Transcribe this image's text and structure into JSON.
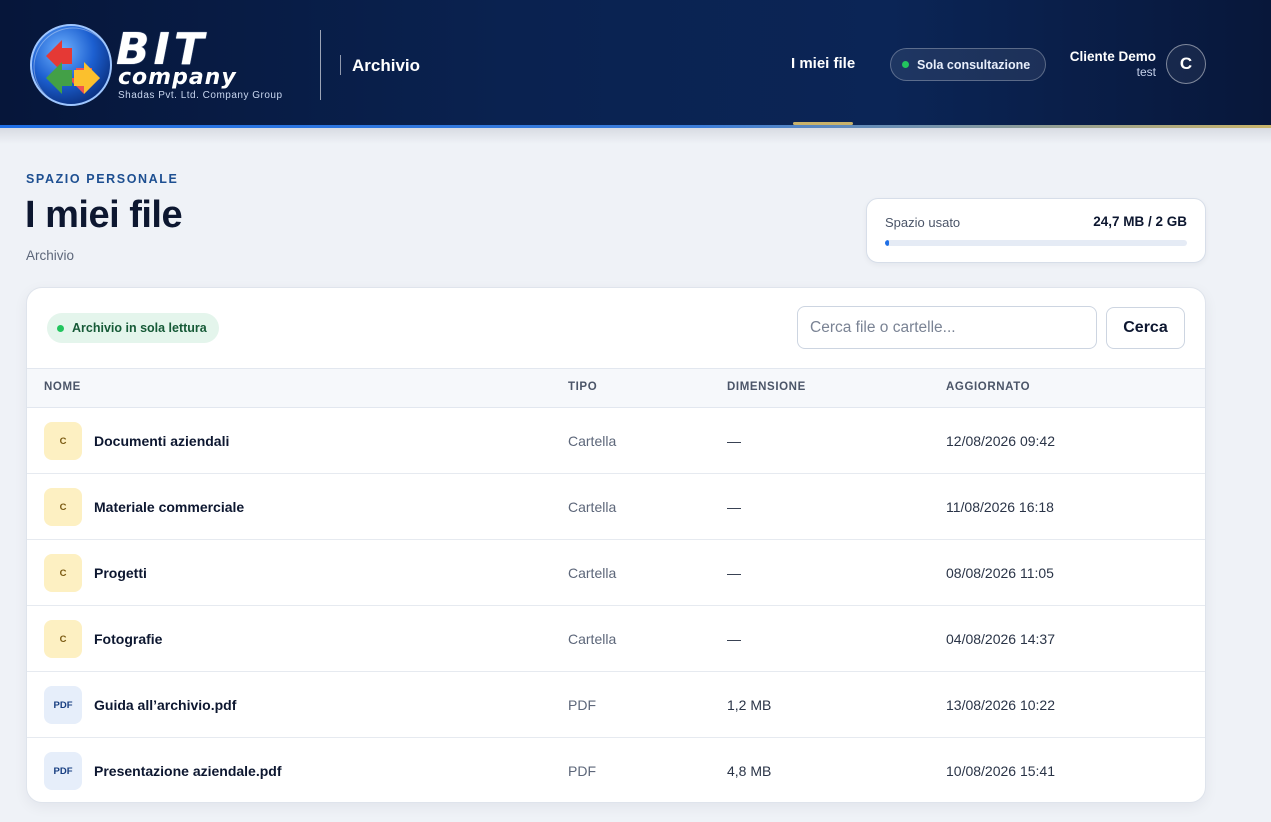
{
  "header": {
    "logo": {
      "word": "BIT",
      "sub": "company",
      "tagline": "Shadas Pvt. Ltd. Company Group"
    },
    "section_title": "Archivio",
    "nav_active": "I miei file",
    "readonly_pill": "Sola consultazione",
    "user": {
      "name": "Cliente Demo",
      "org": "test",
      "initial": "C"
    }
  },
  "page": {
    "eyebrow": "SPAZIO PERSONALE",
    "title": "I miei file",
    "subtitle": "Archivio"
  },
  "storage": {
    "label": "Spazio usato",
    "value": "24,7 MB / 2 GB",
    "used_fraction": 0.012
  },
  "toolbar": {
    "badge": "Archivio in sola lettura",
    "search_placeholder": "Cerca file o cartelle...",
    "search_button": "Cerca"
  },
  "table": {
    "columns": {
      "name": "NOME",
      "type": "TIPO",
      "size": "DIMENSIONE",
      "updated": "AGGIORNATO"
    },
    "rows": [
      {
        "icon": "C",
        "kind": "folder",
        "name": "Documenti aziendali",
        "type": "Cartella",
        "size": "—",
        "updated": "12/08/2026 09:42"
      },
      {
        "icon": "C",
        "kind": "folder",
        "name": "Materiale commerciale",
        "type": "Cartella",
        "size": "—",
        "updated": "11/08/2026 16:18"
      },
      {
        "icon": "C",
        "kind": "folder",
        "name": "Progetti",
        "type": "Cartella",
        "size": "—",
        "updated": "08/08/2026 11:05"
      },
      {
        "icon": "C",
        "kind": "folder",
        "name": "Fotografie",
        "type": "Cartella",
        "size": "—",
        "updated": "04/08/2026 14:37"
      },
      {
        "icon": "PDF",
        "kind": "pdf",
        "name": "Guida all’archivio.pdf",
        "type": "PDF",
        "size": "1,2 MB",
        "updated": "13/08/2026 10:22"
      },
      {
        "icon": "PDF",
        "kind": "pdf",
        "name": "Presentazione aziendale.pdf",
        "type": "PDF",
        "size": "4,8 MB",
        "updated": "10/08/2026 15:41"
      }
    ]
  },
  "colors": {
    "accent": "#1f6fe6",
    "header_bg": "#0a2250",
    "gold": "#c8b26b",
    "success": "#22c55e"
  }
}
